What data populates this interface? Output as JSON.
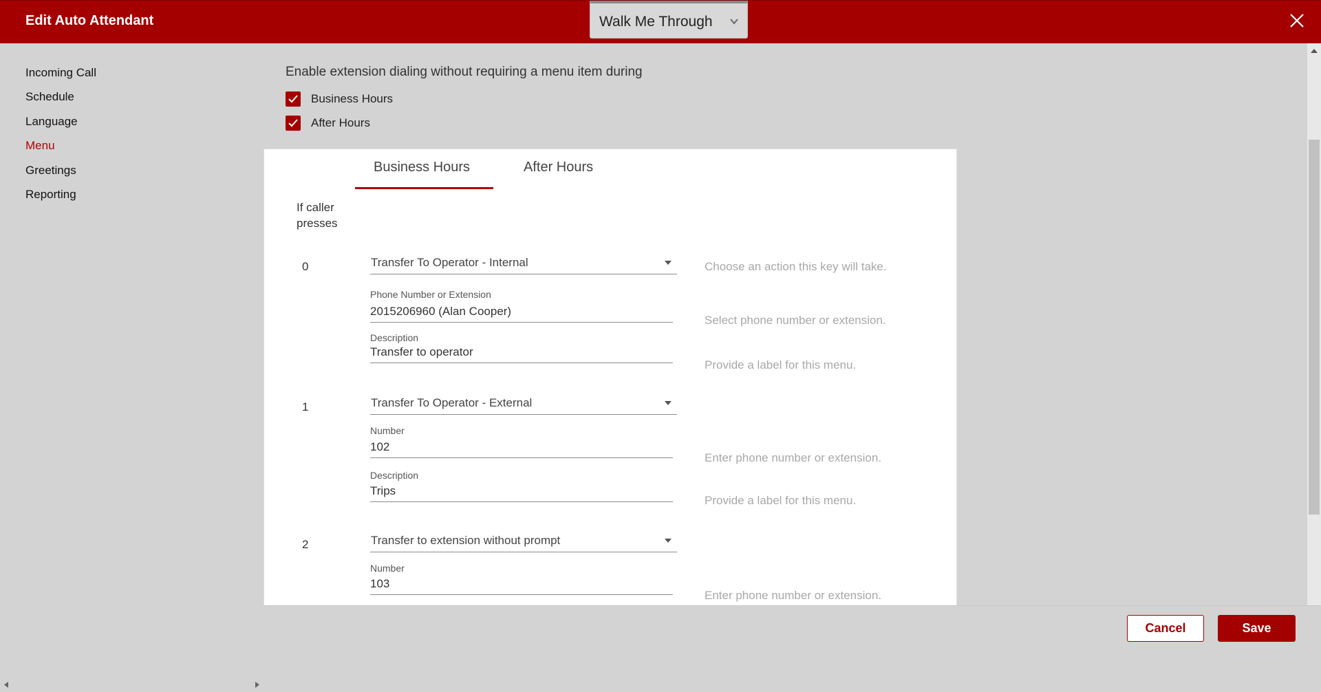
{
  "header": {
    "title": "Edit Auto Attendant",
    "walkme_label": "Walk Me Through"
  },
  "sidebar": {
    "items": [
      {
        "label": "Incoming Call",
        "active": false
      },
      {
        "label": "Schedule",
        "active": false
      },
      {
        "label": "Language",
        "active": false
      },
      {
        "label": "Menu",
        "active": true
      },
      {
        "label": "Greetings",
        "active": false
      },
      {
        "label": "Reporting",
        "active": false
      }
    ]
  },
  "extension_dialing": {
    "text": "Enable extension dialing without requiring a menu item during",
    "options": [
      {
        "label": "Business Hours",
        "checked": true
      },
      {
        "label": "After Hours",
        "checked": true
      }
    ]
  },
  "tabs": [
    {
      "label": "Business Hours",
      "selected": true
    },
    {
      "label": "After Hours",
      "selected": false
    }
  ],
  "menu": {
    "key_column_header": "If caller presses",
    "entries": [
      {
        "key": "0",
        "action": "Transfer To Operator - Internal",
        "action_hint": "Choose an action this key will take.",
        "target_label": "Phone Number or Extension",
        "target_value": "2015206960 (Alan Cooper)",
        "target_hint": "Select phone number or extension.",
        "description_label": "Description",
        "description_value": "Transfer to operator",
        "description_hint": "Provide a label for this menu."
      },
      {
        "key": "1",
        "action": "Transfer To Operator - External",
        "target_label": "Number",
        "target_value": "102",
        "target_hint": "Enter phone number or extension.",
        "description_label": "Description",
        "description_value": "Trips",
        "description_hint": "Provide a label for this menu."
      },
      {
        "key": "2",
        "action": "Transfer to extension without prompt",
        "target_label": "Number",
        "target_value": "103",
        "target_hint": "Enter phone number or extension."
      }
    ]
  },
  "footer": {
    "cancel_label": "Cancel",
    "save_label": "Save"
  },
  "colors": {
    "brand": "#a50000",
    "background": "#d3d3d3",
    "hint": "#a8a8a8"
  }
}
